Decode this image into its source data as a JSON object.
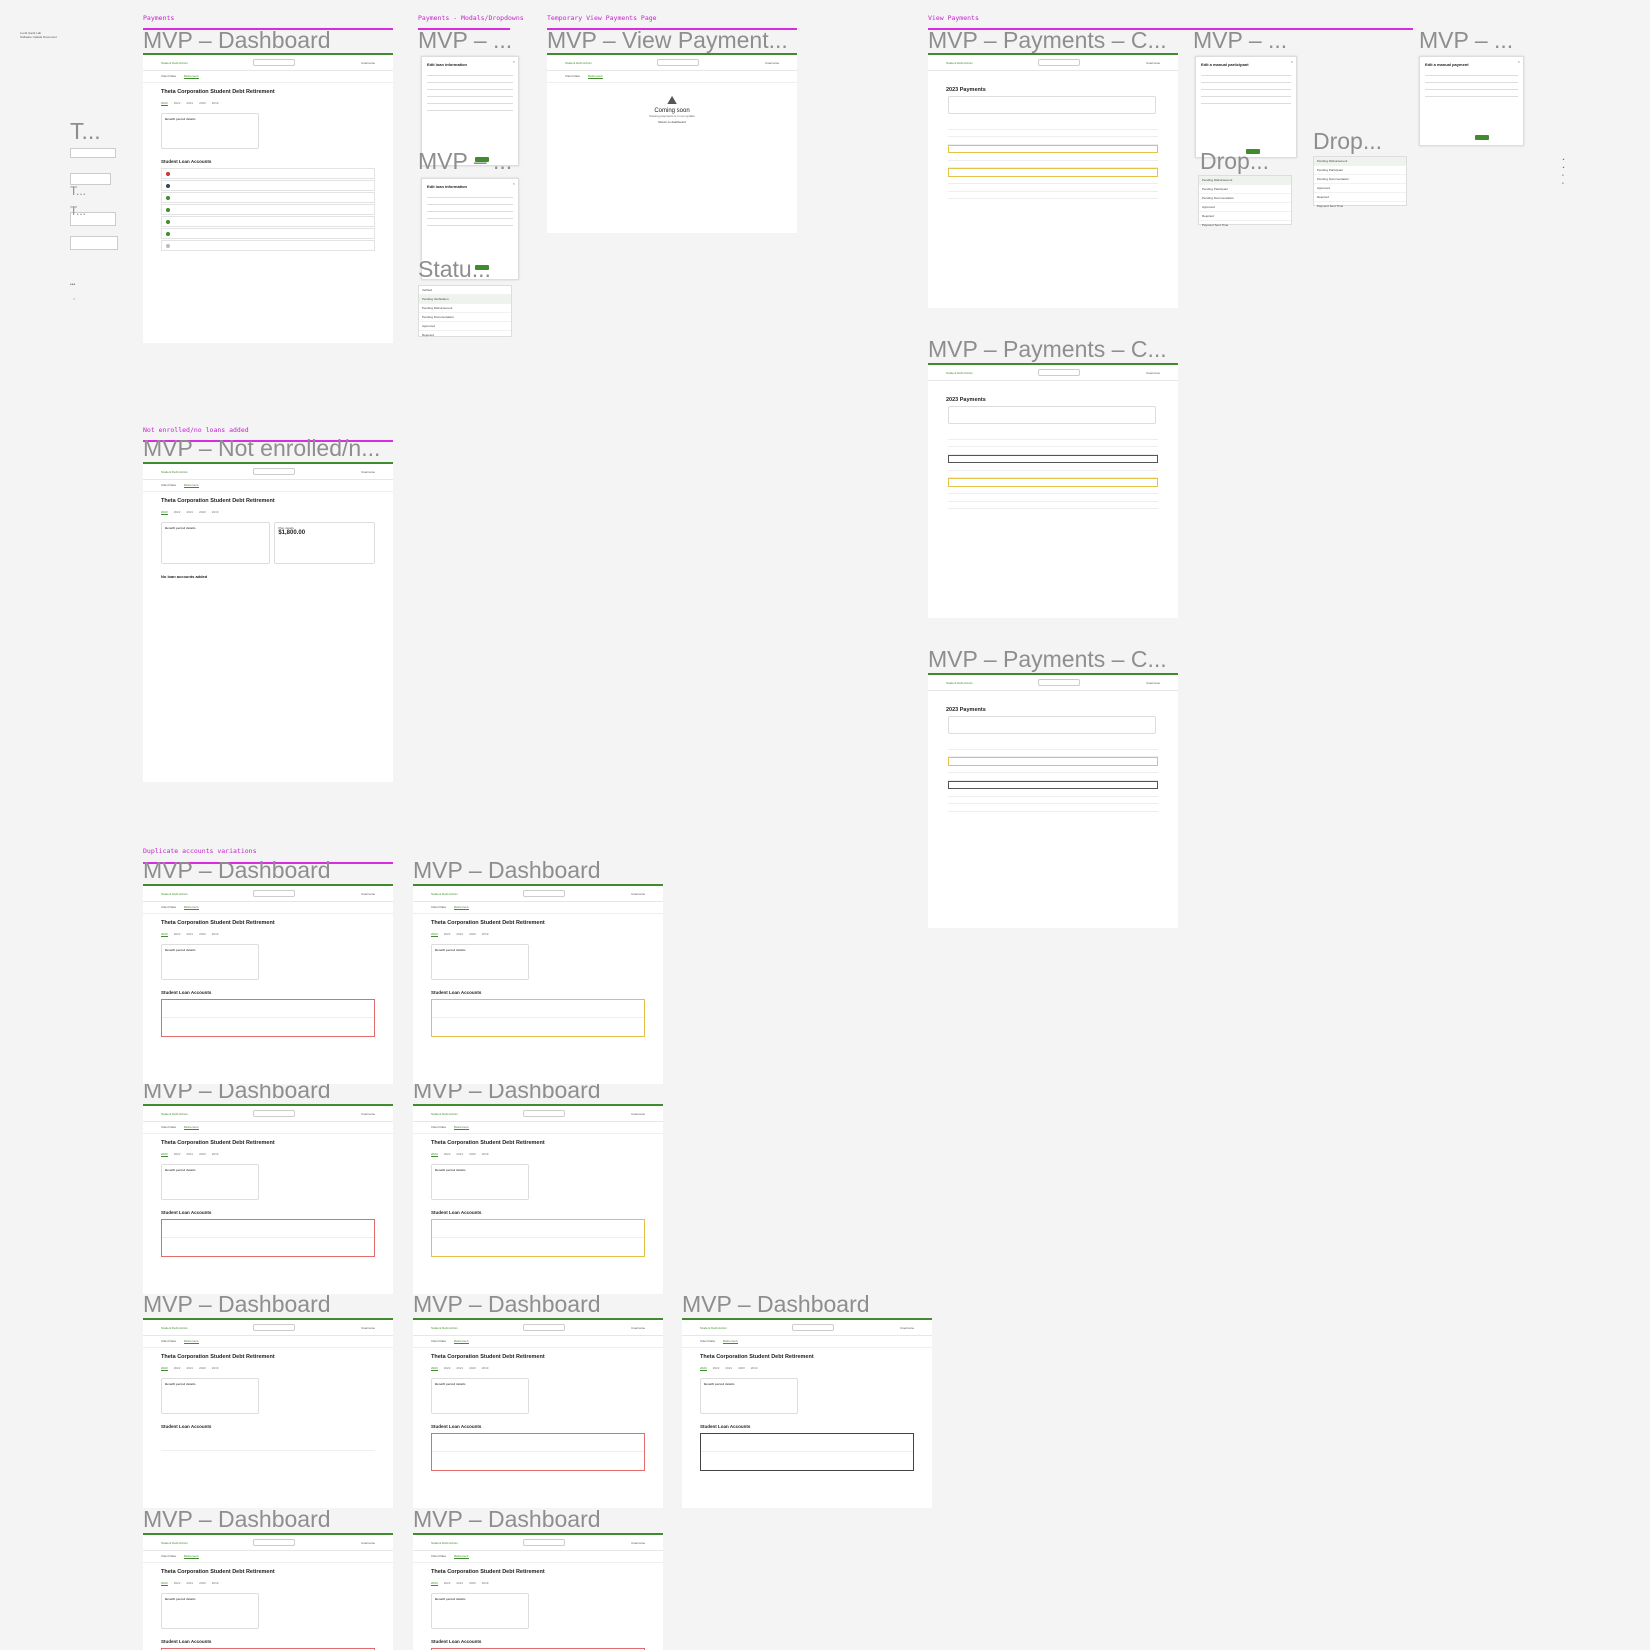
{
  "corner_note": {
    "line1": "Lucid Gantt Lab",
    "line2": "Software Update Document"
  },
  "sections": {
    "payments": "Payments",
    "modals": "Payments - Modals/Dropdowns",
    "temp_view": "Temporary View Payments Page",
    "view_payments": "View Payments",
    "not_enrolled": "Not enrolled/no loans added",
    "duplicate": "Duplicate accounts variations"
  },
  "frame_titles": {
    "dashboard": "MVP – Dashboard",
    "modal_a": "MVP – ...",
    "modal_b": "MVP – ...",
    "status": "Statu...",
    "view_payment": "MVP – View Payment...",
    "payments_c1": "MVP – Payments – C...",
    "payments_c2": "MVP – Payments – C...",
    "payments_c3": "MVP – Payments – C...",
    "mvp_right1": "MVP – ...",
    "mvp_right2": "MVP – ...",
    "drop1": "Drop...",
    "drop2": "Drop...",
    "not_enrolled": "MVP – Not enrolled/n...",
    "t1": "T...",
    "t2": "T...",
    "t3": "T..."
  },
  "app": {
    "brand": "Student Debt Admin",
    "user": "Username",
    "company_title": "Theta Corporation Student Debt Retirement",
    "years": [
      "2023",
      "2022",
      "2021",
      "2020",
      "2019"
    ],
    "student_loan_heading": "Student Loan Accounts",
    "benefit_heading": "Benefit period details",
    "no_loans": "No loan accounts added",
    "plan_amount": "$1,800.00",
    "plan_label": "Plan details",
    "retirement_tab": "Retirement"
  },
  "modals": {
    "edit_loan": "Edit loan information",
    "edit_manual_participant": "Edit a manual participant",
    "edit_manual_payment": "Edit a manual payment",
    "save": "Save"
  },
  "coming_soon": {
    "title": "Coming soon",
    "line1": "Viewing payments is in our update",
    "line2": "Return to dashboard"
  },
  "payments_heading": "2023 Payments",
  "status_options": [
    "Verified",
    "Pending Verification",
    "Pending Disbursement",
    "Pending Documentation",
    "Approved",
    "Rejected"
  ],
  "drop_options": [
    "Pending Disbursement",
    "Pending Participant",
    "Pending Documentation",
    "Approved",
    "Rejected",
    "Payment Sent Time"
  ]
}
